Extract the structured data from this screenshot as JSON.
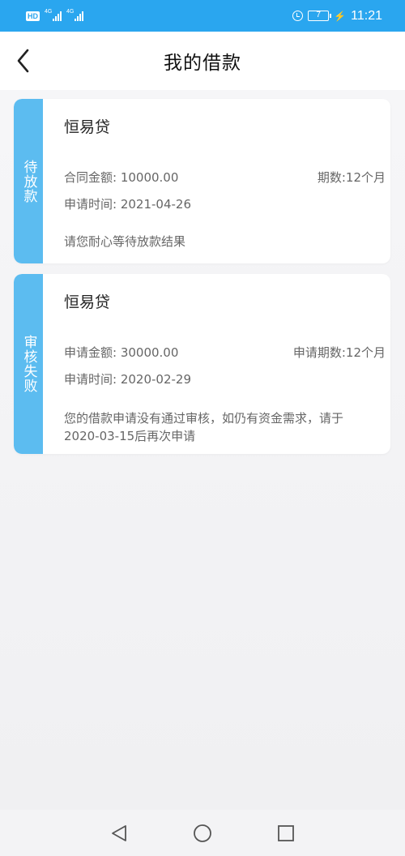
{
  "status_bar": {
    "hd": "HD",
    "net1": "4G",
    "net2": "4G",
    "battery": "7",
    "time": "11:21"
  },
  "header": {
    "title": "我的借款"
  },
  "loans": [
    {
      "status": "待放款",
      "lender": "恒易贷",
      "amount_text": "合同金额: 10000.00",
      "term_text": "期数:12个月",
      "time_text": "申请时间: 2021-04-26",
      "note": "请您耐心等待放款结果"
    },
    {
      "status": "审核失败",
      "lender": "恒易贷",
      "amount_text": "申请金额: 30000.00",
      "term_text": "申请期数:12个月",
      "time_text": "申请时间: 2020-02-29",
      "note_line1": "您的借款申请没有通过审核，如仍有资金需求，请于",
      "note_line2": "2020-03-15后再次申请"
    }
  ],
  "colors": {
    "status_bar": "#2aa6ef",
    "status_tab": "#5cbcf0"
  },
  "nav_icons": [
    "back-triangle-icon",
    "home-circle-icon",
    "recents-square-icon"
  ]
}
